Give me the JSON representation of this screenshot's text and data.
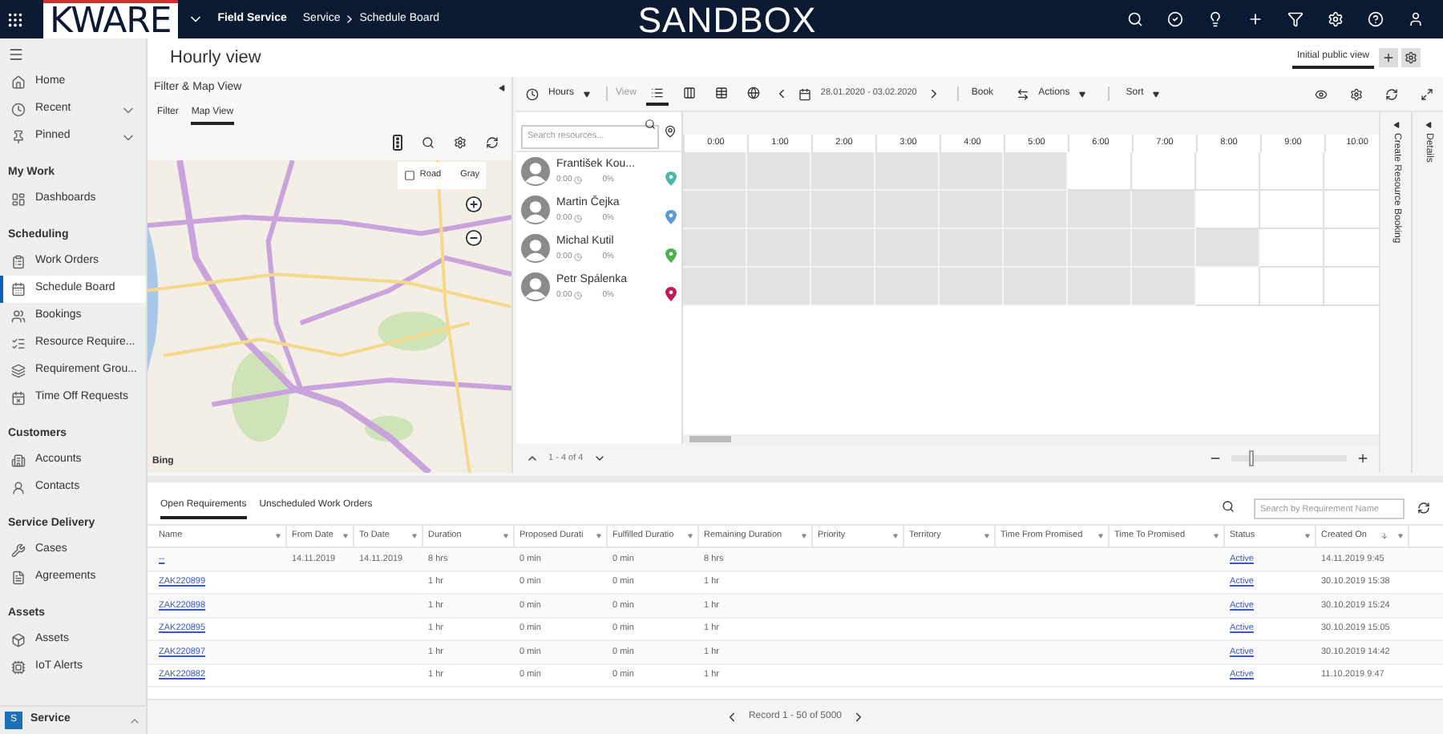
{
  "topbar": {
    "logo": "KWARE",
    "app_name": "Field Service",
    "breadcrumb": [
      "Service",
      "Schedule Board"
    ],
    "banner": "SANDBOX"
  },
  "sidebar": {
    "groups": [
      {
        "items": [
          {
            "kind": "home",
            "label": "Home"
          },
          {
            "kind": "recent",
            "label": "Recent",
            "expanded": false
          },
          {
            "kind": "pin",
            "label": "Pinned",
            "expanded": false
          }
        ]
      },
      {
        "title": "My Work",
        "items": [
          {
            "kind": "dashboard",
            "label": "Dashboards",
            "selected": false
          }
        ]
      },
      {
        "title": "Scheduling",
        "items": [
          {
            "kind": "orders",
            "label": "Work Orders",
            "selected": false
          },
          {
            "kind": "board",
            "label": "Schedule Board",
            "selected": true
          },
          {
            "kind": "bookings",
            "label": "Bookings",
            "selected": false
          },
          {
            "kind": "requirements",
            "label": "Resource Require...",
            "selected": false
          },
          {
            "kind": "groups",
            "label": "Requirement Grou...",
            "selected": false
          },
          {
            "kind": "timeoff",
            "label": "Time Off Requests",
            "selected": false
          }
        ]
      },
      {
        "title": "Customers",
        "items": [
          {
            "kind": "accounts",
            "label": "Accounts",
            "selected": false
          },
          {
            "kind": "contacts",
            "label": "Contacts",
            "selected": false
          }
        ]
      },
      {
        "title": "Service Delivery",
        "items": [
          {
            "kind": "cases",
            "label": "Cases",
            "selected": false
          },
          {
            "kind": "agreements",
            "label": "Agreements",
            "selected": false
          }
        ]
      },
      {
        "title": "Assets",
        "items": [
          {
            "kind": "assets",
            "label": "Assets",
            "selected": false
          },
          {
            "kind": "iot",
            "label": "IoT Alerts",
            "selected": false
          }
        ]
      }
    ],
    "footer": {
      "badge": "S",
      "label": "Service"
    }
  },
  "page": {
    "title": "Hourly view",
    "view_selector": "Initial public view"
  },
  "filter_panel": {
    "title": "Filter & Map View",
    "tabs": [
      {
        "label": "Filter",
        "selected": false
      },
      {
        "label": "Map View",
        "selected": true
      }
    ],
    "map": {
      "kind": "picture",
      "layers": [
        {
          "label": "Road"
        },
        {
          "label": "Gray"
        }
      ],
      "logo": "Bing"
    }
  },
  "schedule": {
    "toolbar": {
      "scale": "Hours",
      "view_label": "View",
      "views": [
        {
          "kind": "list",
          "selected": true
        },
        {
          "kind": "columns",
          "selected": false
        },
        {
          "kind": "table",
          "selected": false
        },
        {
          "kind": "globe",
          "selected": false
        }
      ],
      "date_range": "28.01.2020 - 03.02.2020",
      "book": "Book",
      "actions": "Actions",
      "sort": "Sort"
    },
    "search_placeholder": "Search resources...",
    "hours": [
      "0:00",
      "1:00",
      "2:00",
      "3:00",
      "4:00",
      "5:00",
      "6:00",
      "7:00",
      "8:00",
      "9:00",
      "10:00"
    ],
    "resources": [
      {
        "name": "František Kou...",
        "time": "0:00",
        "percent": "0%",
        "color": "#4db6ac",
        "available": [
          false,
          false,
          false,
          false,
          false,
          false,
          true,
          true,
          true,
          true,
          true
        ]
      },
      {
        "name": "Martin Čejka",
        "time": "0:00",
        "percent": "0%",
        "color": "#5b9bd5",
        "available": [
          false,
          false,
          false,
          false,
          false,
          false,
          false,
          false,
          true,
          true,
          true
        ]
      },
      {
        "name": "Michal Kutil",
        "time": "0:00",
        "percent": "0%",
        "color": "#4caf50",
        "available": [
          false,
          false,
          false,
          false,
          false,
          false,
          false,
          false,
          false,
          true,
          true
        ]
      },
      {
        "name": "Petr Spálenka",
        "time": "0:00",
        "percent": "0%",
        "color": "#c2185b",
        "available": [
          false,
          false,
          false,
          false,
          false,
          false,
          false,
          false,
          true,
          true,
          true
        ]
      }
    ],
    "pager": "1 - 4 of 4",
    "booking_rail": "Create Resource Booking",
    "details_rail": "Details",
    "zoom": {
      "level": 0.15
    }
  },
  "requirements": {
    "tabs": [
      {
        "label": "Open Requirements",
        "selected": true
      },
      {
        "label": "Unscheduled Work Orders",
        "selected": false
      }
    ],
    "search_placeholder": "Search by Requirement Name",
    "columns": [
      "Name",
      "From Date",
      "To Date",
      "Duration",
      "Proposed Durati",
      "Fulfilled Duratio",
      "Remaining Duration",
      "Priority",
      "Territory",
      "Time From Promised",
      "Time To Promised",
      "Status",
      "Created On"
    ],
    "rows": [
      {
        "name": "--",
        "from_date": "14.11.2019",
        "to_date": "14.11.2019",
        "duration": "8 hrs",
        "proposed": "0 min",
        "fulfilled": "0 min",
        "remaining": "8 hrs",
        "status": "Active",
        "created_on": "14.11.2019 9:45"
      },
      {
        "name": "ZAK220899",
        "duration": "1 hr",
        "proposed": "0 min",
        "fulfilled": "0 min",
        "remaining": "1 hr",
        "status": "Active",
        "created_on": "30.10.2019 15:38"
      },
      {
        "name": "ZAK220898",
        "duration": "1 hr",
        "proposed": "0 min",
        "fulfilled": "0 min",
        "remaining": "1 hr",
        "status": "Active",
        "created_on": "30.10.2019 15:24"
      },
      {
        "name": "ZAK220895",
        "duration": "1 hr",
        "proposed": "0 min",
        "fulfilled": "0 min",
        "remaining": "1 hr",
        "status": "Active",
        "created_on": "30.10.2019 15:05"
      },
      {
        "name": "ZAK220897",
        "duration": "1 hr",
        "proposed": "0 min",
        "fulfilled": "0 min",
        "remaining": "1 hr",
        "status": "Active",
        "created_on": "30.10.2019 14:42"
      },
      {
        "name": "ZAK220882",
        "duration": "1 hr",
        "proposed": "0 min",
        "fulfilled": "0 min",
        "remaining": "1 hr",
        "status": "Active",
        "created_on": "11.10.2019 9:47"
      }
    ],
    "pager": "Record 1 - 50 of 5000"
  }
}
